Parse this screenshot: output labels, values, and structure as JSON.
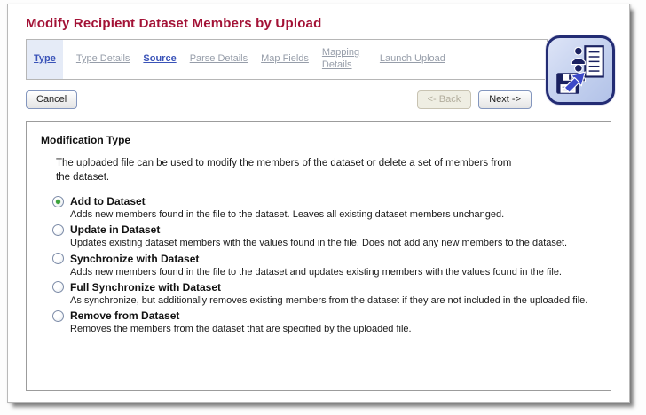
{
  "page": {
    "title": "Modify Recipient Dataset Members by Upload"
  },
  "wizard_steps": [
    {
      "label": "Type",
      "state": "current"
    },
    {
      "label": "Type Details",
      "state": "upcoming"
    },
    {
      "label": "Source",
      "state": "visited"
    },
    {
      "label": "Parse Details",
      "state": "upcoming"
    },
    {
      "label": "Map Fields",
      "state": "upcoming"
    },
    {
      "label": "Mapping Details",
      "state": "upcoming"
    },
    {
      "label": "Launch Upload",
      "state": "upcoming"
    }
  ],
  "toolbar": {
    "cancel_label": "Cancel",
    "back_label": "<- Back",
    "back_disabled": true,
    "next_label": "Next ->"
  },
  "icons": {
    "header_icon": "dataset-upload-save-icon"
  },
  "section": {
    "heading": "Modification Type",
    "intro": "The uploaded file can be used to modify the members of the dataset or delete a set of members from the dataset.",
    "options": [
      {
        "label": "Add to Dataset",
        "selected": true,
        "description": "Adds new members found in the file to the dataset. Leaves all existing dataset members unchanged."
      },
      {
        "label": "Update in Dataset",
        "selected": false,
        "description": "Updates existing dataset members with the values found in the file. Does not add any new members to the dataset."
      },
      {
        "label": "Synchronize with Dataset",
        "selected": false,
        "description": "Adds new members found in the file to the dataset and updates existing members with the values found in the file."
      },
      {
        "label": "Full Synchronize with Dataset",
        "selected": false,
        "description": "As synchronize, but additionally removes existing members from the dataset if they are not included in the uploaded file."
      },
      {
        "label": "Remove from Dataset",
        "selected": false,
        "description": "Removes the members from the dataset that are specified by the uploaded file."
      }
    ]
  },
  "colors": {
    "title": "#a31236",
    "step_active": "#3a53b8",
    "step_inactive": "#969da9",
    "step_highlight_bg": "#e5ebf7",
    "icon_border": "#232c74",
    "icon_bg": "#c3d0ee",
    "radio_selected_dot": "#3ba43b"
  }
}
